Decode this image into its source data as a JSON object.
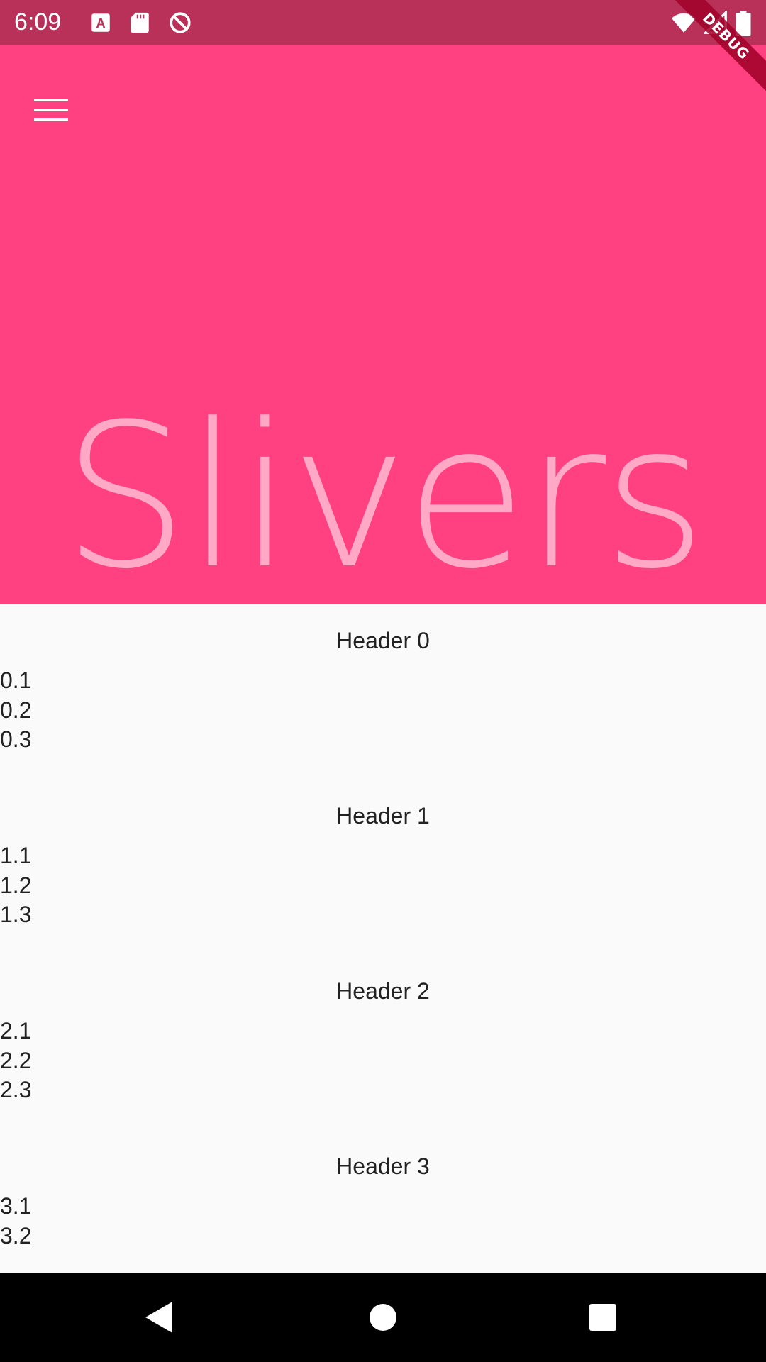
{
  "status_bar": {
    "time": "6:09",
    "background": "#b93059",
    "left_icons": [
      "font-a-icon",
      "sd-card-icon",
      "no-sync-icon"
    ],
    "right_icons": [
      "wifi-icon",
      "cell-signal-icon",
      "battery-icon"
    ]
  },
  "app_bar": {
    "title": "Slivers",
    "background": "#ff4081",
    "menu_icon": "hamburger-menu-icon"
  },
  "debug_banner": {
    "label": "DEBUG"
  },
  "sections": [
    {
      "header": "Header 0",
      "items": [
        "0.1",
        "0.2",
        "0.3"
      ]
    },
    {
      "header": "Header 1",
      "items": [
        "1.1",
        "1.2",
        "1.3"
      ]
    },
    {
      "header": "Header 2",
      "items": [
        "2.1",
        "2.2",
        "2.3"
      ]
    },
    {
      "header": "Header 3",
      "items": [
        "3.1",
        "3.2"
      ]
    }
  ],
  "nav_bar": {
    "buttons": [
      "back-icon",
      "home-icon",
      "recents-icon"
    ]
  }
}
